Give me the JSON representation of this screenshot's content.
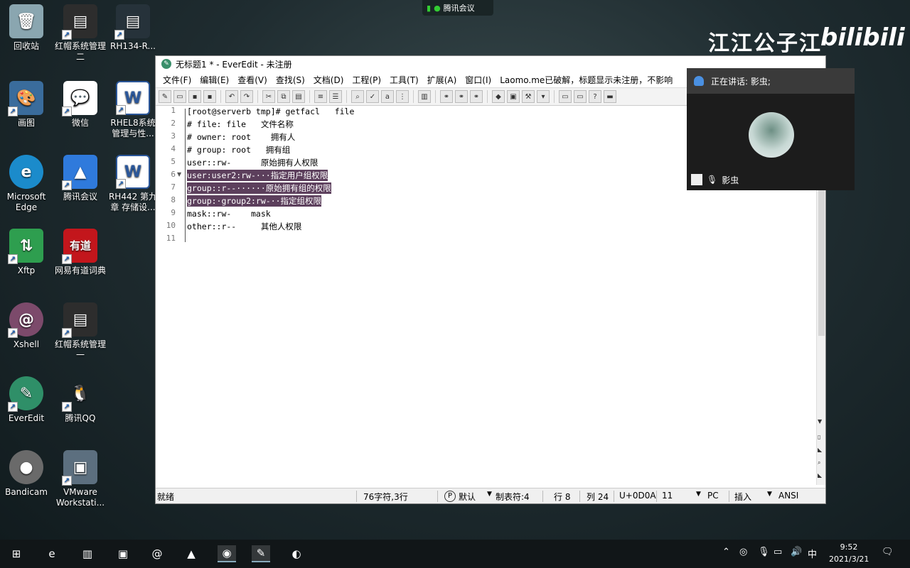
{
  "desktop": {
    "icons": [
      {
        "label": "回收站",
        "glyph": "🗑",
        "color": "#8aa6b0"
      },
      {
        "label": "红帽系统管理二",
        "glyph": "▤",
        "color": "#2d2d2d"
      },
      {
        "label": "RH134-R...",
        "glyph": "▤",
        "color": "#26323a"
      },
      {
        "label": "画图",
        "glyph": "🎨",
        "color": "#3a6c9c"
      },
      {
        "label": "微信",
        "glyph": "💬",
        "color": "#ffffff"
      },
      {
        "label": "RHEL8系统管理与性...",
        "glyph": "W",
        "color": "#2b579a"
      },
      {
        "label": "Microsoft Edge",
        "glyph": "e",
        "color": "#1b8bcb"
      },
      {
        "label": "腾讯会议",
        "glyph": "▲",
        "color": "#2f7adc"
      },
      {
        "label": "RH442 第九章 存储设...",
        "glyph": "W",
        "color": "#2b579a"
      },
      {
        "label": "Xftp",
        "glyph": "⇅",
        "color": "#2e9e4f"
      },
      {
        "label": "网易有道词典",
        "glyph": "有道",
        "color": "#c3161c"
      },
      {
        "label": "Xshell",
        "glyph": "@",
        "color": "#7c4a6b"
      },
      {
        "label": "红帽系统管理一",
        "glyph": "▤",
        "color": "#2d2d2d"
      },
      {
        "label": "EverEdit",
        "glyph": "✎",
        "color": "#2f8f68"
      },
      {
        "label": "腾讯QQ",
        "glyph": "🐧",
        "color": "#000000"
      },
      {
        "label": "Bandicam",
        "glyph": "●",
        "color": "#6a6a6a"
      },
      {
        "label": "VMware Workstati...",
        "glyph": "▣",
        "color": "#5c6f7f"
      }
    ]
  },
  "overlay": {
    "meeting_badge": "腾讯会议",
    "watermark_text": "江江公子江",
    "watermark_logo": "bilibili"
  },
  "editor": {
    "title": "无标题1 * - EverEdit - 未注册",
    "menu": [
      "文件(F)",
      "编辑(E)",
      "查看(V)",
      "查找(S)",
      "文档(D)",
      "工程(P)",
      "工具(T)",
      "扩展(A)",
      "窗口(I)",
      "Laomo.me已破解，标题显示未注册，不影响"
    ],
    "lines": [
      "[root@serverb tmp]# getfacl   file",
      "# file: file   文件名称",
      "# owner: root    拥有人",
      "# group: root   拥有组",
      "user::rw-      原始拥有人权限",
      "user:user2:rw-···指定用户组权限",
      "group::r--······原始拥有组的权限",
      "group:·group2:rw-··指定组权限",
      "mask::rw-    mask",
      "other::r--     其他人权限",
      ""
    ],
    "line_numbers": [
      "1",
      "2",
      "3",
      "4",
      "5",
      "6",
      "7",
      "8",
      "9",
      "10",
      "11"
    ],
    "selected_lines": [
      5,
      6,
      7
    ],
    "status": {
      "ready": "就绪",
      "chars": "76字符,3行",
      "mode": "默认",
      "tab": "制表符:4",
      "row": "行 8",
      "col": "列 24",
      "unicode": "U+0D0A",
      "code": "11",
      "eol": "PC",
      "insert": "插入",
      "encoding": "ANSI"
    }
  },
  "call_panel": {
    "speaking": "正在讲话: 影虫;",
    "participant": "影虫"
  },
  "taskbar": {
    "time": "9:52",
    "date": "2021/3/21",
    "ime": "中"
  }
}
